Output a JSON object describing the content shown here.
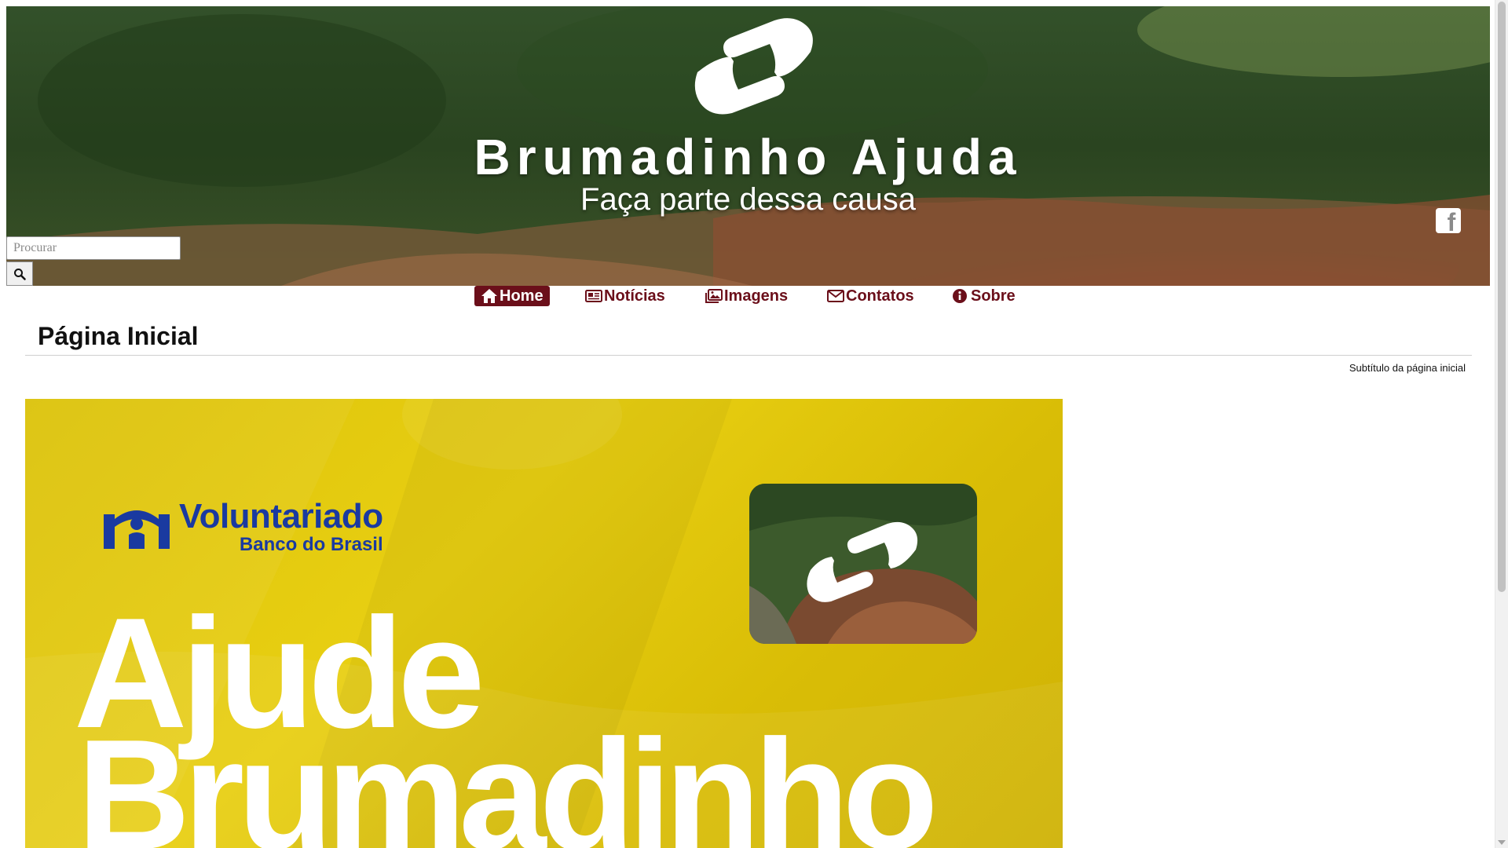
{
  "header": {
    "site_title": "Brumadinho Ajuda",
    "tagline": "Faça parte dessa causa",
    "logo_icon": "handshake-icon",
    "social_icon": "facebook-icon"
  },
  "search": {
    "placeholder": "Procurar",
    "value": "",
    "button_icon": "search-icon"
  },
  "nav": {
    "items": [
      {
        "label": "Home",
        "icon": "home-icon",
        "active": true
      },
      {
        "label": "Notícias",
        "icon": "newspaper-icon",
        "active": false
      },
      {
        "label": "Imagens",
        "icon": "images-icon",
        "active": false
      },
      {
        "label": "Contatos",
        "icon": "envelope-icon",
        "active": false
      },
      {
        "label": "Sobre",
        "icon": "info-circle-icon",
        "active": false
      }
    ]
  },
  "main": {
    "page_title": "Página Inicial",
    "page_subtitle": "Subtítulo da página inicial"
  },
  "promo": {
    "brand_main": "Voluntariado",
    "brand_sub": "Banco do Brasil",
    "headline_line1": "Ajude",
    "headline_line2": "Brumadinho"
  },
  "colors": {
    "nav_accent": "#6b0f1a",
    "promo_yellow": "#dcc20a",
    "brand_blue": "#1a3aa0"
  }
}
